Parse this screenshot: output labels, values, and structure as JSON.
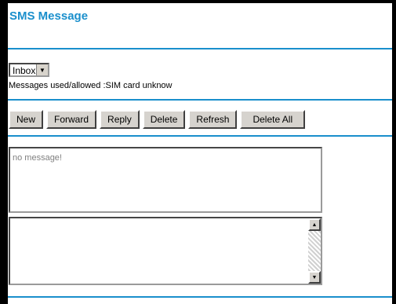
{
  "page": {
    "title": "SMS Message"
  },
  "folder_select": {
    "selected": "Inbox"
  },
  "usage_text": "Messages used/allowed :SIM card unknow",
  "toolbar": {
    "new_label": "New",
    "forward_label": "Forward",
    "reply_label": "Reply",
    "delete_label": "Delete",
    "refresh_label": "Refresh",
    "delete_all_label": "Delete All"
  },
  "message_list": {
    "empty_text": "no message!"
  },
  "colors": {
    "accent": "#1a8fcc",
    "frame": "#000000"
  },
  "icons": {
    "dropdown": "chevron-down-icon",
    "scroll_up": "scroll-up-icon",
    "scroll_down": "scroll-down-icon"
  }
}
